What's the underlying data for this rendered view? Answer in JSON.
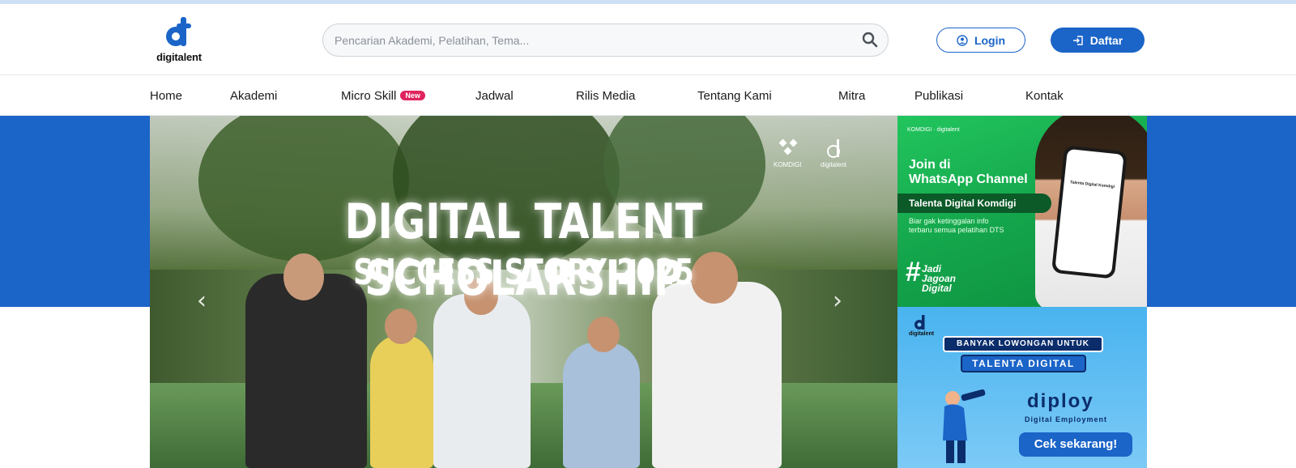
{
  "brand": {
    "logo_text": "digitalent",
    "accent": "#1b64c8"
  },
  "search": {
    "placeholder": "Pencarian Akademi, Pelatihan, Tema..."
  },
  "auth": {
    "login_label": "Login",
    "register_label": "Daftar"
  },
  "nav": {
    "items": [
      {
        "label": "Home"
      },
      {
        "label": "Akademi"
      },
      {
        "label": "Micro Skill",
        "badge": "New"
      },
      {
        "label": "Jadwal"
      },
      {
        "label": "Rilis Media"
      },
      {
        "label": "Tentang Kami"
      },
      {
        "label": "Mitra"
      },
      {
        "label": "Publikasi"
      },
      {
        "label": "Kontak"
      }
    ]
  },
  "hero": {
    "title": "DIGITAL TALENT SCHOLARSHIP",
    "subtitle": "SUCCESS STORY 2025",
    "logo_left": "KOMDIGI",
    "logo_right": "digitalent"
  },
  "banner_whatsapp": {
    "logos": "KOMDIGI · digitalent",
    "heading_line1": "Join di",
    "heading_line2": "WhatsApp Channel",
    "channel_name": "Talenta Digital Komdigi",
    "description": "Biar gak ketinggalan info terbaru semua pelatihan DTS",
    "hashtag_line1": "Jadi",
    "hashtag_line2": "Jagoan",
    "hashtag_line3": "Digital",
    "phone_title": "Talenta Digital Komdigi"
  },
  "banner_diploy": {
    "logo_text": "digitalent",
    "headline": "BANYAK LOWONGAN UNTUK",
    "highlight": "TALENTA DIGITAL",
    "brand": "diploy",
    "tagline": "Digital Employment",
    "cta": "Cek sekarang!"
  }
}
